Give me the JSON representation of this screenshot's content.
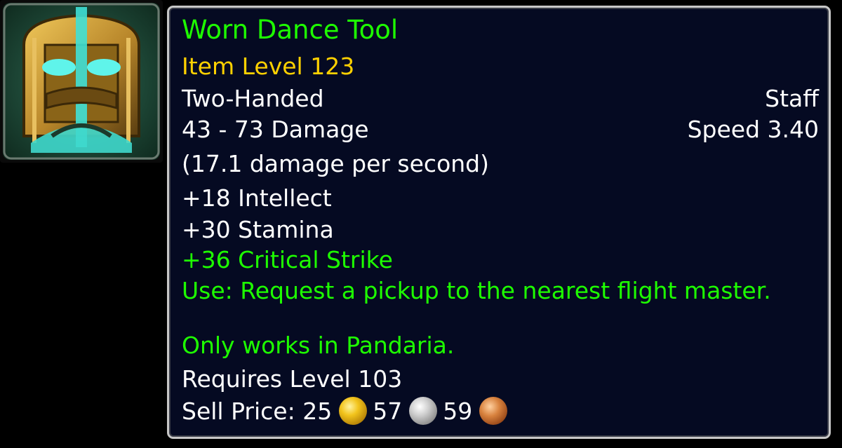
{
  "item_icon": {
    "icon": "golden-mask-icon",
    "colors": {
      "gold": "#c99a2e",
      "teal": "#3fe0d6",
      "frame": "#1c3a2c"
    }
  },
  "tooltip": {
    "name": "Worn Dance Tool",
    "item_level": "Item Level 123",
    "slot": "Two-Handed",
    "type": "Staff",
    "damage": "43 - 73 Damage",
    "speed": "Speed 3.40",
    "dps": "(17.1 damage per second)",
    "stats": [
      "+18 Intellect",
      "+30 Stamina"
    ],
    "bonus_stat": "+36 Critical Strike",
    "use_text": "Use: Request a pickup to the nearest flight master.",
    "restriction": "Only works in Pandaria.",
    "requires": "Requires Level 103",
    "sell_price": {
      "label": "Sell Price:",
      "gold": "25",
      "silver": "57",
      "copper": "59"
    }
  },
  "colors": {
    "name": "#1eff00",
    "item_level": "#ffd100",
    "text": "#ffffff",
    "background": "#050a22",
    "border": "#c8c8c8"
  }
}
